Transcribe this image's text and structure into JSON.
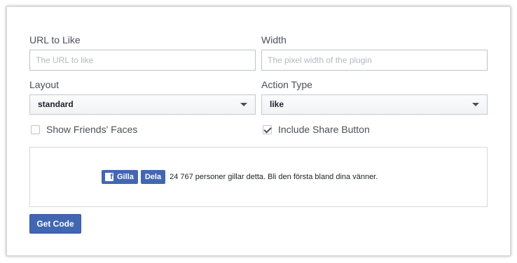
{
  "form": {
    "url_label": "URL to Like",
    "url_placeholder": "The URL to like",
    "width_label": "Width",
    "width_placeholder": "The pixel width of the plugin",
    "layout_label": "Layout",
    "layout_value": "standard",
    "action_label": "Action Type",
    "action_value": "like",
    "show_faces_label": "Show Friends' Faces",
    "show_faces_checked": false,
    "share_label": "Include Share Button",
    "share_checked": true
  },
  "preview": {
    "like_label": "Gilla",
    "share_label": "Dela",
    "like_text": "24 767 personer gillar detta. Bli den första bland dina vänner."
  },
  "actions": {
    "get_code_label": "Get Code"
  },
  "colors": {
    "brand": "#4267b2",
    "text": "#4b4f56"
  }
}
